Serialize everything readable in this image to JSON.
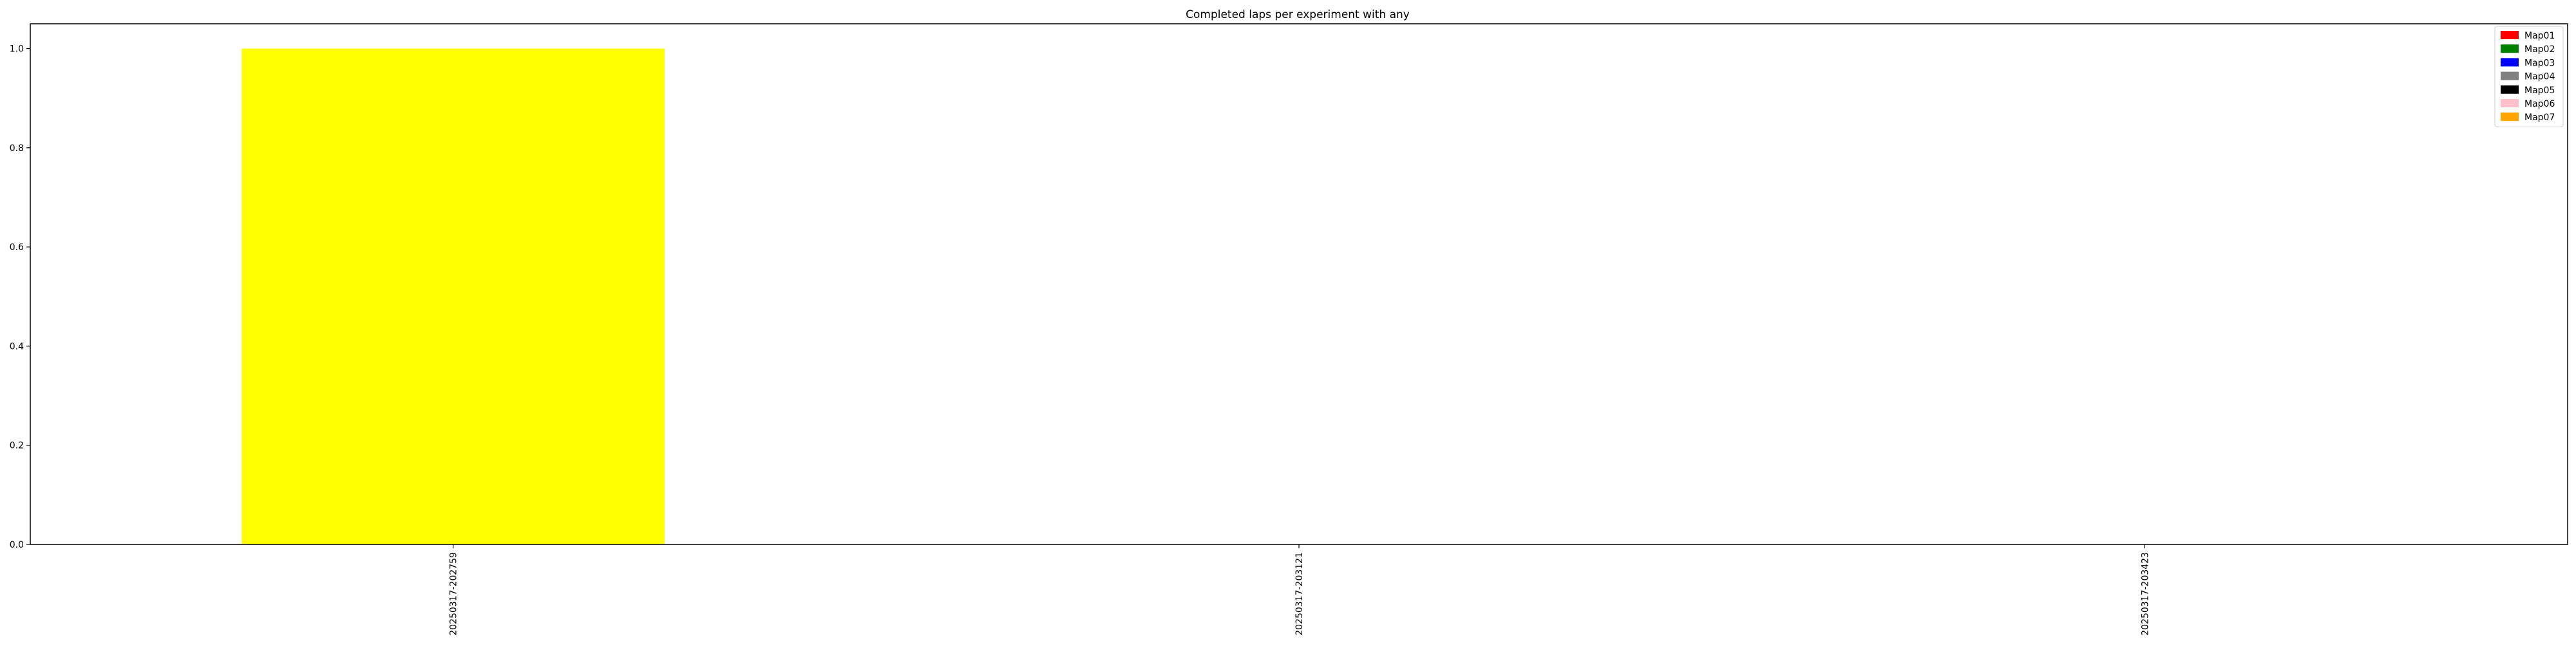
{
  "chart_data": {
    "type": "bar",
    "title": "Completed laps per experiment with any",
    "xlabel": "",
    "ylabel": "",
    "categories": [
      "20250317-202759",
      "20250317-203121",
      "20250317-203423"
    ],
    "series": [
      {
        "name": "",
        "values": [
          1,
          0,
          0
        ],
        "color": "#ffff00"
      }
    ],
    "ylim": [
      0,
      1.05
    ],
    "yticks": [
      "0.0",
      "0.2",
      "0.4",
      "0.6",
      "0.8",
      "1.0"
    ],
    "grid": false,
    "legend": {
      "placement": "top-right",
      "entries": [
        {
          "label": "Map01",
          "color": "#ff0000"
        },
        {
          "label": "Map02",
          "color": "#008000"
        },
        {
          "label": "Map03",
          "color": "#0000ff"
        },
        {
          "label": "Map04",
          "color": "#808080"
        },
        {
          "label": "Map05",
          "color": "#000000"
        },
        {
          "label": "Map06",
          "color": "#ffc0cb"
        },
        {
          "label": "Map07",
          "color": "#ffa500"
        }
      ]
    }
  }
}
